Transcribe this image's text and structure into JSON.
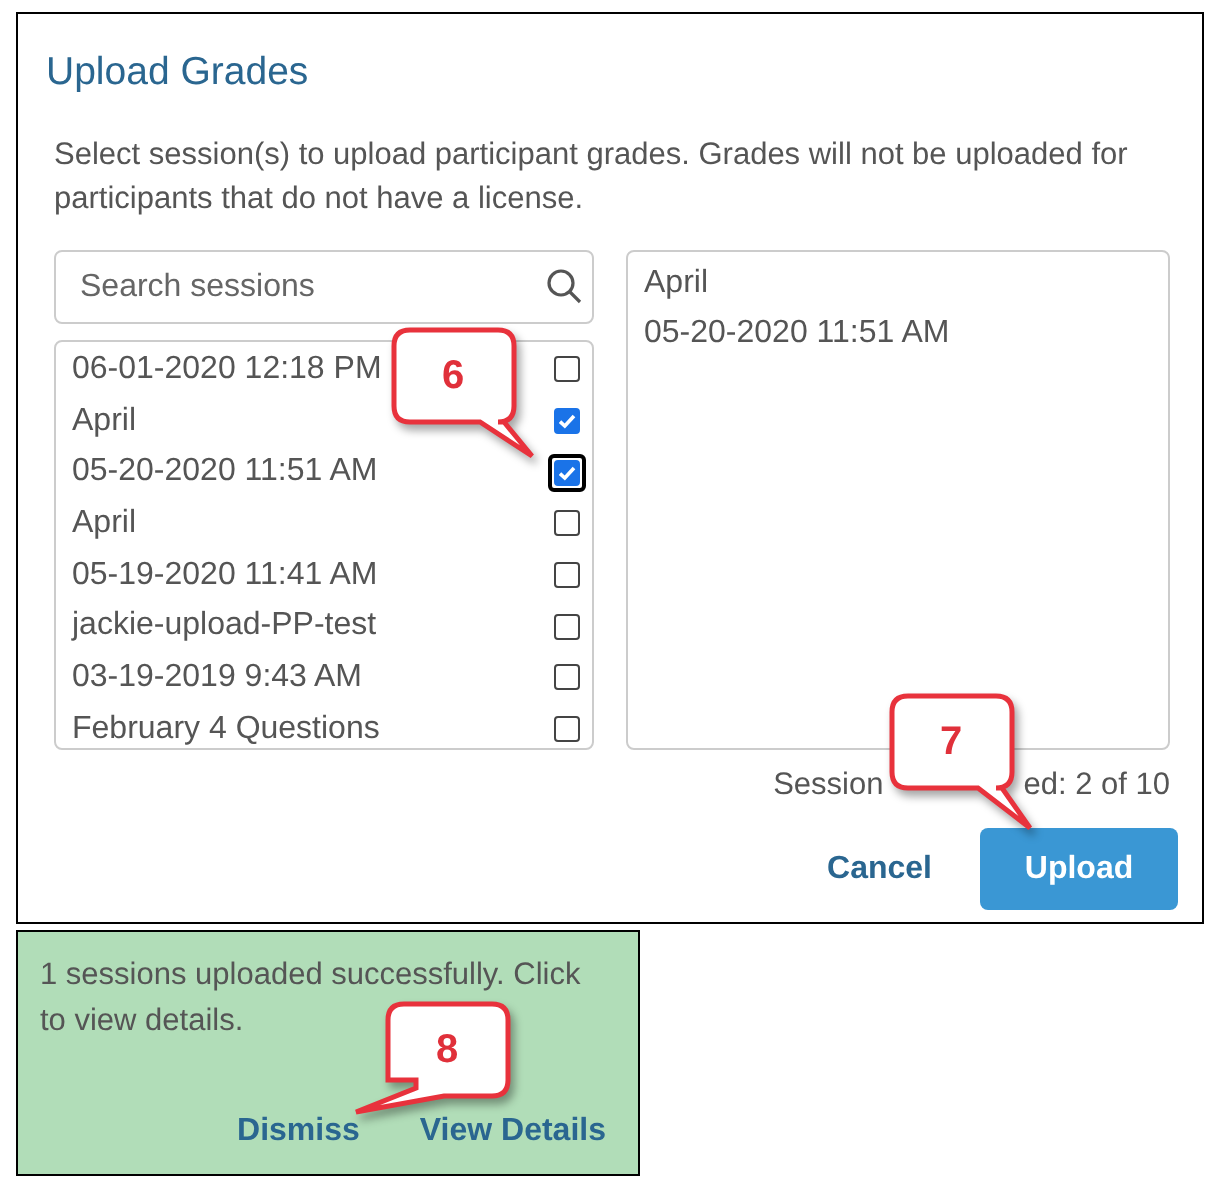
{
  "dialog": {
    "title": "Upload Grades",
    "description": "Select session(s) to upload participant grades. Grades will not be uploaded for participants that do not have a license.",
    "search": {
      "placeholder": "Search sessions"
    },
    "sessions": [
      {
        "label": "06-01-2020 12:18 PM",
        "checked": false,
        "focused": false
      },
      {
        "label": "April",
        "checked": true,
        "focused": false
      },
      {
        "label": "05-20-2020 11:51 AM",
        "checked": true,
        "focused": true
      },
      {
        "label": "April",
        "checked": false,
        "focused": false
      },
      {
        "label": "05-19-2020 11:41 AM",
        "checked": false,
        "focused": false
      },
      {
        "label": "jackie-upload-PP-test",
        "checked": false,
        "focused": false
      },
      {
        "label": "03-19-2019 9:43 AM",
        "checked": false,
        "focused": false
      },
      {
        "label": "February 4 Questions",
        "checked": false,
        "focused": false
      }
    ],
    "selected_sessions": [
      "April",
      "05-20-2020 11:51 AM"
    ],
    "selection_count_parts": [
      "Session",
      "ed: 2 of 10"
    ],
    "buttons": [
      {
        "label": "Cancel",
        "kind": "link"
      },
      {
        "label": "Upload",
        "kind": "primary"
      }
    ]
  },
  "toast": {
    "message": "1 sessions uploaded successfully. Click to view details.",
    "actions": [
      "Dismiss",
      "View Details"
    ]
  },
  "callouts": [
    {
      "label": "6"
    },
    {
      "label": "7"
    },
    {
      "label": "8"
    }
  ]
}
